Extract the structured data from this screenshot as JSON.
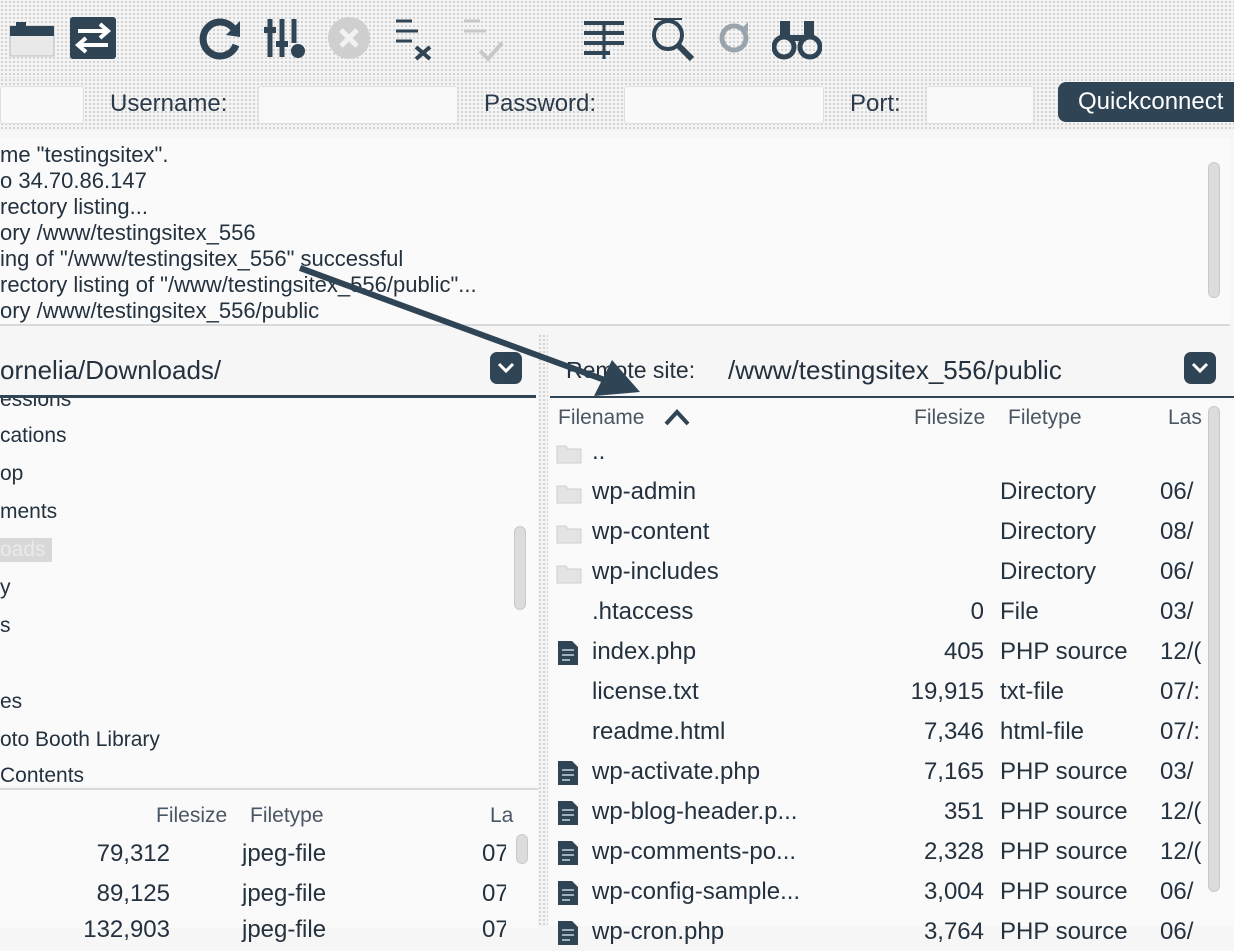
{
  "toolbar": {
    "icons": [
      "site-manager-icon",
      "toggle-sync-icon",
      "refresh-icon",
      "filter-icon",
      "cancel-icon",
      "disconnect-icon",
      "reconnect-icon",
      "queue-icon",
      "search-remote-icon",
      "compare-icon",
      "find-icon"
    ]
  },
  "quickconnect": {
    "username_label": "Username:",
    "password_label": "Password:",
    "port_label": "Port:",
    "button_label": "Quickconnect"
  },
  "log": {
    "lines": [
      "me \"testingsitex\".",
      "o 34.70.86.147",
      "rectory listing...",
      "ory /www/testingsitex_556",
      "ing of \"/www/testingsitex_556\" successful",
      "rectory listing of \"/www/testingsitex_556/public\"...",
      "ory /www/testingsitex_556/public"
    ]
  },
  "local": {
    "path": "ornelia/Downloads/",
    "tree": [
      "essions",
      "cations",
      "op",
      "ments",
      "oads",
      "y",
      "s",
      "",
      "es",
      "oto Booth Library",
      "Contents"
    ],
    "columns": {
      "filesize": "Filesize",
      "filetype": "Filetype",
      "last": "La"
    },
    "files": [
      {
        "size": "79,312",
        "type": "jpeg-file",
        "date": "07"
      },
      {
        "size": "89,125",
        "type": "jpeg-file",
        "date": "07"
      },
      {
        "size": "132,903",
        "type": "jpeg-file",
        "date": "07"
      }
    ]
  },
  "remote": {
    "label": "Remote site:",
    "path": "/www/testingsitex_556/public",
    "columns": {
      "filename": "Filename",
      "filesize": "Filesize",
      "filetype": "Filetype",
      "last": "Las"
    },
    "files": [
      {
        "name": "..",
        "size": "",
        "type": "",
        "date": "",
        "icon": "folder"
      },
      {
        "name": "wp-admin",
        "size": "",
        "type": "Directory",
        "date": "06/",
        "icon": "folder"
      },
      {
        "name": "wp-content",
        "size": "",
        "type": "Directory",
        "date": "08/",
        "icon": "folder"
      },
      {
        "name": "wp-includes",
        "size": "",
        "type": "Directory",
        "date": "06/",
        "icon": "folder"
      },
      {
        "name": ".htaccess",
        "size": "0",
        "type": "File",
        "date": "03/",
        "icon": "none"
      },
      {
        "name": "index.php",
        "size": "405",
        "type": "PHP source",
        "date": "12/(",
        "icon": "php"
      },
      {
        "name": "license.txt",
        "size": "19,915",
        "type": "txt-file",
        "date": "07/:",
        "icon": "none"
      },
      {
        "name": "readme.html",
        "size": "7,346",
        "type": "html-file",
        "date": "07/:",
        "icon": "none"
      },
      {
        "name": "wp-activate.php",
        "size": "7,165",
        "type": "PHP source",
        "date": "03/",
        "icon": "php"
      },
      {
        "name": "wp-blog-header.p...",
        "size": "351",
        "type": "PHP source",
        "date": "12/(",
        "icon": "php"
      },
      {
        "name": "wp-comments-po...",
        "size": "2,328",
        "type": "PHP source",
        "date": "12/(",
        "icon": "php"
      },
      {
        "name": "wp-config-sample...",
        "size": "3,004",
        "type": "PHP source",
        "date": "06/",
        "icon": "php"
      },
      {
        "name": "wp-cron.php",
        "size": "3,764",
        "type": "PHP source",
        "date": "06/",
        "icon": "php"
      }
    ]
  },
  "colors": {
    "accent": "#2f4556",
    "arrow": "#2f4556"
  }
}
